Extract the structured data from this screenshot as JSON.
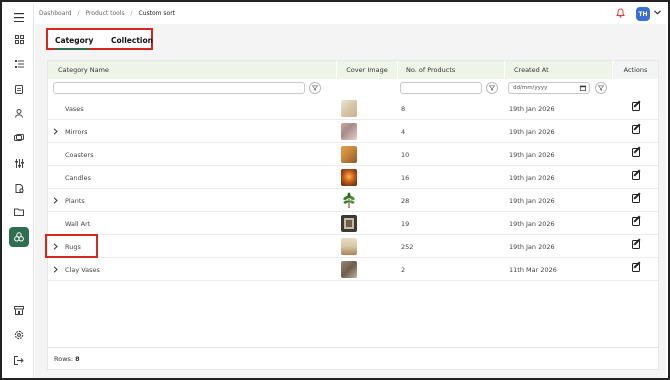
{
  "breadcrumb": [
    "Dashboard",
    "Product tools",
    "Custom sort"
  ],
  "user": {
    "initials": "TH"
  },
  "tabs": [
    {
      "label": "Category"
    },
    {
      "label": "Collection"
    }
  ],
  "table": {
    "headers": [
      "Category Name",
      "Cover Image",
      "No. of Products",
      "Created At",
      "Actions"
    ],
    "date_placeholder": "dd/mm/yyyy",
    "rows": [
      {
        "name": "Vases",
        "expandable": false,
        "products": "8",
        "created": "19th Jan 2026",
        "thumb": "vases-image"
      },
      {
        "name": "Mirrors",
        "expandable": true,
        "products": "4",
        "created": "19th Jan 2026",
        "thumb": "mirrors-image"
      },
      {
        "name": "Coasters",
        "expandable": false,
        "products": "10",
        "created": "19th Jan 2026",
        "thumb": "coasters-image"
      },
      {
        "name": "Candles",
        "expandable": false,
        "products": "16",
        "created": "19th Jan 2026",
        "thumb": "candles-image"
      },
      {
        "name": "Plants",
        "expandable": true,
        "products": "28",
        "created": "19th Jan 2026",
        "thumb": "plants-image"
      },
      {
        "name": "Wall Art",
        "expandable": false,
        "products": "19",
        "created": "19th Jan 2026",
        "thumb": "wall-art-image"
      },
      {
        "name": "Rugs",
        "expandable": true,
        "products": "252",
        "created": "19th Jan 2026",
        "thumb": "rugs-image"
      },
      {
        "name": "Clay Vases",
        "expandable": true,
        "products": "2",
        "created": "11th Mar 2026",
        "thumb": "clay-vases-image"
      }
    ]
  },
  "footer": {
    "rows_label": "Rows:",
    "rows_count": "8"
  },
  "colors": {
    "accent": "#2f6f4f",
    "header_bg": "#eef4e8",
    "highlight": "#d7261e",
    "notification": "#e03b3b",
    "avatar": "#3a6fd1"
  },
  "icons": {
    "menu": "hamburger-icon",
    "sidebar": [
      "dashboard-icon",
      "list-icon",
      "document-icon",
      "user-icon",
      "tags-icon",
      "sliders-icon",
      "file-icon",
      "folder-icon",
      "product-tools-icon",
      "store-icon",
      "settings-icon",
      "logout-icon"
    ],
    "notification": "bell-icon",
    "dropdown": "chevron-down-icon",
    "filter": "filter-icon",
    "calendar": "calendar-icon",
    "edit": "edit-icon",
    "expand": "chevron-right-icon"
  }
}
